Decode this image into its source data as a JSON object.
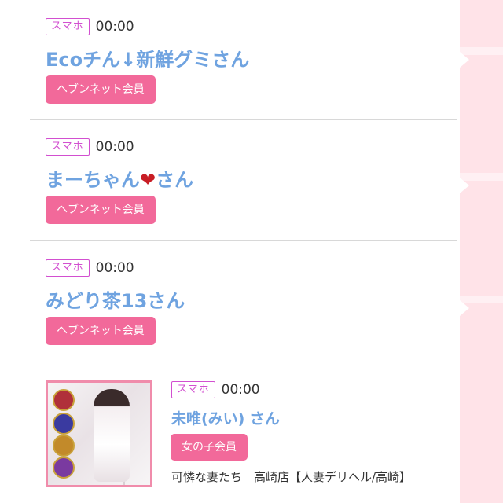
{
  "entries": [
    {
      "device": "スマホ",
      "time": "00:00",
      "name": "Ecoチん↓新鮮グミさん",
      "member": "ヘブンネット会員"
    },
    {
      "device": "スマホ",
      "time": "00:00",
      "name_pre": "まーちゃん",
      "heart": "❤",
      "name_post": "さん",
      "member": "ヘブンネット会員"
    },
    {
      "device": "スマホ",
      "time": "00:00",
      "name": "みどり茶13さん",
      "member": "ヘブンネット会員"
    },
    {
      "device": "スマホ",
      "time": "00:00",
      "name": "未唯(みい) さん",
      "member": "女の子会員",
      "shop": "可憐な妻たち　高崎店【人妻デリヘル/高崎】"
    }
  ],
  "colors": {
    "accent": "#f2699a",
    "name_blue": "#6fa3e0",
    "device_badge": "#d24fd0",
    "side_strip": "#ffe3e8"
  }
}
